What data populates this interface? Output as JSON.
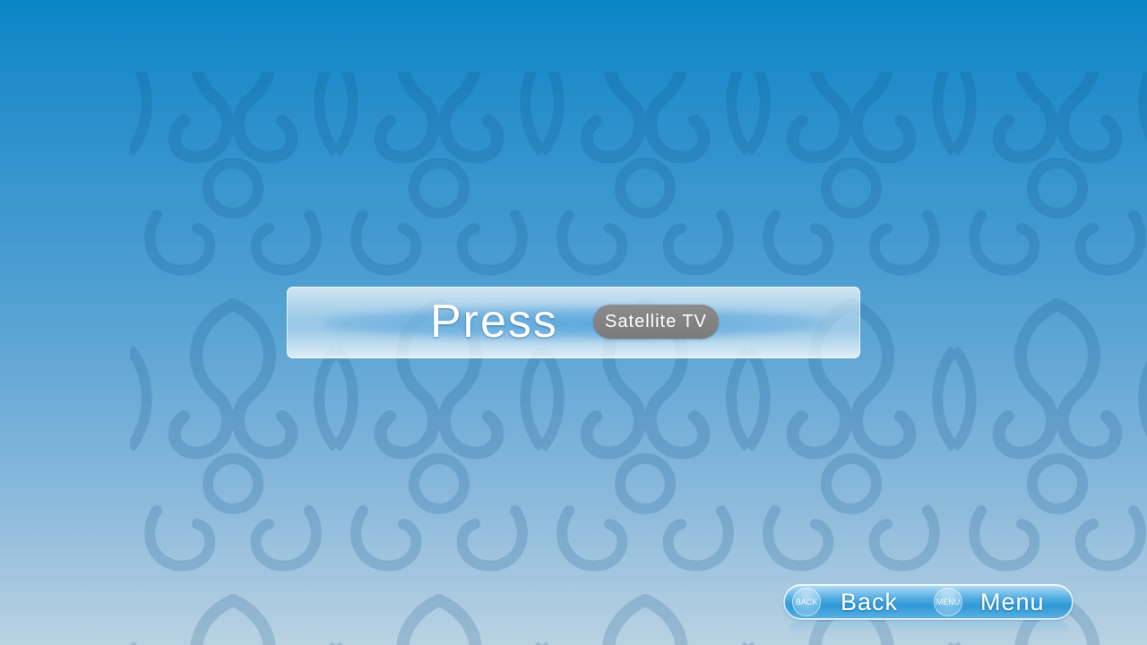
{
  "dialog": {
    "message": "Press",
    "key_label": "Satellite TV"
  },
  "nav": {
    "back": {
      "icon_text": "BACK",
      "label": "Back"
    },
    "menu": {
      "icon_text": "MENU",
      "label": "Menu"
    }
  },
  "colors": {
    "background_top": "#0a86c6",
    "background_bottom": "#b9d2e2",
    "badge": "#808080",
    "text": "#ffffff"
  }
}
